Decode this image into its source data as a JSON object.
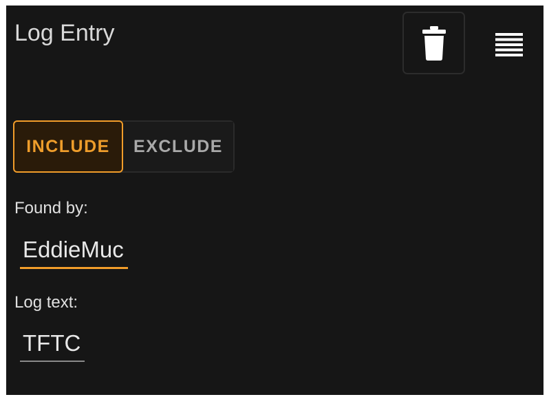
{
  "header": {
    "title": "Log Entry",
    "delete_icon": "trash-icon",
    "menu_icon": "menu-lines-icon"
  },
  "filter_toggle": {
    "include_label": "INCLUDE",
    "exclude_label": "EXCLUDE",
    "selected": "INCLUDE"
  },
  "found_by": {
    "label": "Found by:",
    "value": "EddieMuc"
  },
  "log_text": {
    "label": "Log text:",
    "value": "TFTC"
  },
  "colors": {
    "background": "#161616",
    "accent": "#f29d2a",
    "text": "#e6e6e6"
  }
}
